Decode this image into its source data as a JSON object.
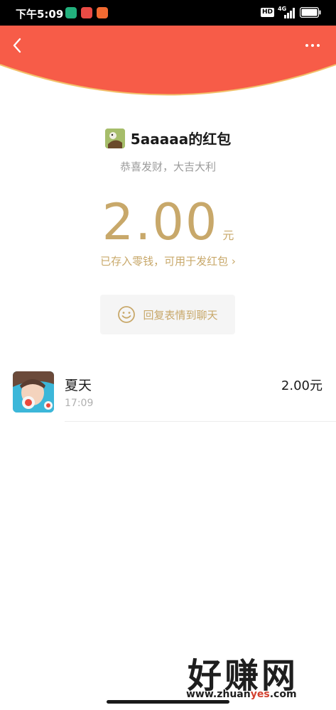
{
  "status_bar": {
    "time": "下午5:09",
    "hd": "HD",
    "network": "4G"
  },
  "header": {
    "back_icon": "chevron-left-icon",
    "more_icon": "more-dots-icon",
    "accent_color": "#f75c48"
  },
  "sender": {
    "name": "5aaaaa的红包",
    "blessing": "恭喜发财，大吉大利"
  },
  "amount": {
    "value": "2.00",
    "unit": "元",
    "deposit_note": "已存入零钱，可用于发红包 ›",
    "color": "#c8a86a"
  },
  "reply": {
    "icon": "smile-icon",
    "label": "回复表情到聊天"
  },
  "receivers": [
    {
      "name": "夏天",
      "time": "17:09",
      "amount": "2.00元"
    }
  ],
  "watermark": {
    "text": "好赚网",
    "url_prefix": "www.zhuan",
    "url_highlight": "yes",
    "url_suffix": ".com"
  }
}
